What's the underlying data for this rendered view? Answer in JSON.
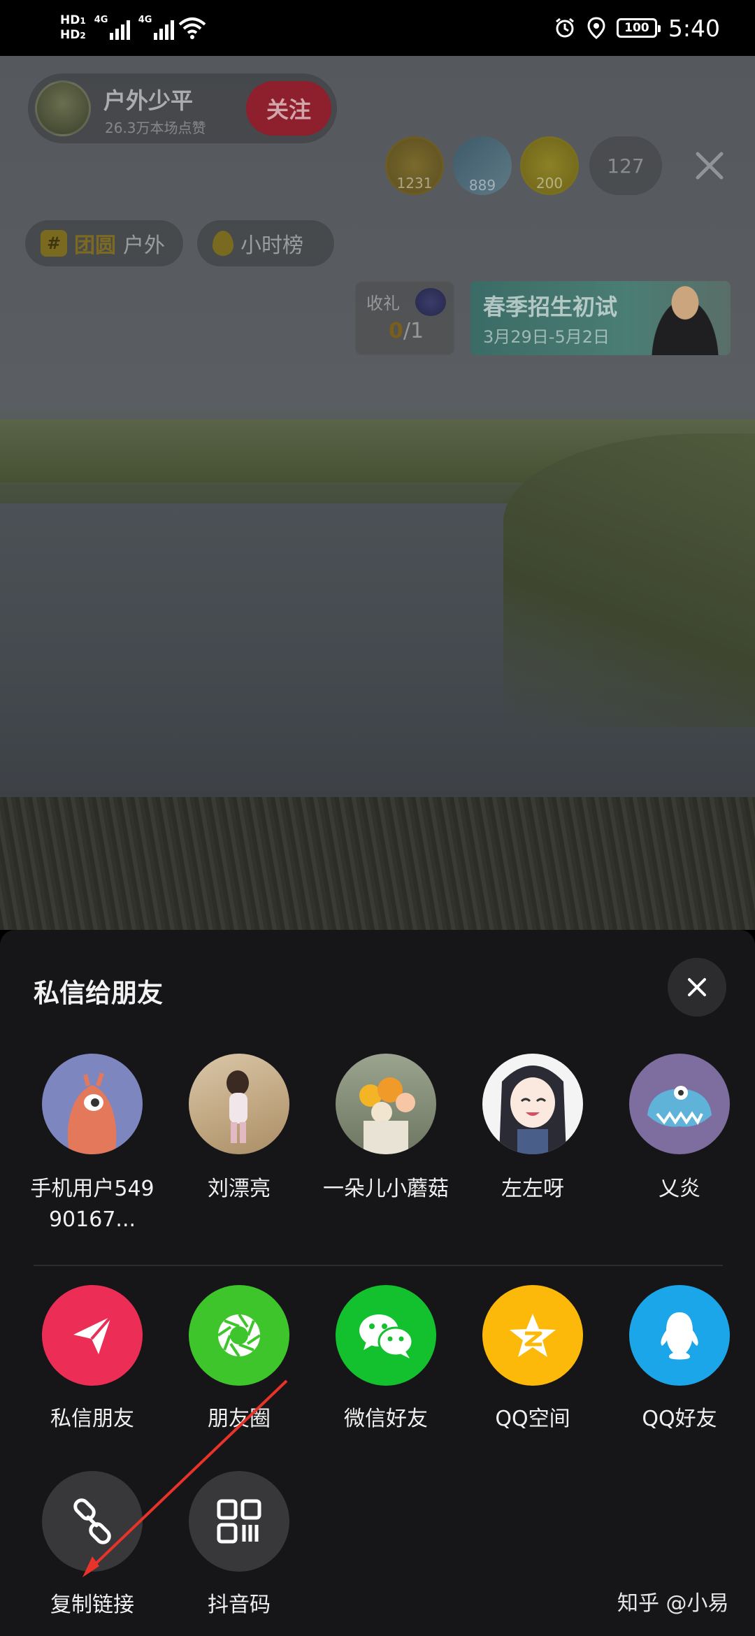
{
  "status_bar": {
    "hd1": "HD",
    "hd1_sub": "1",
    "hd2": "HD",
    "hd2_sub": "2",
    "net1": "4G",
    "net2": "4G",
    "battery": "100",
    "time": "5:40"
  },
  "live": {
    "host_name": "户外少平",
    "host_likes": "26.3万本场点赞",
    "follow_label": "关注",
    "viewers": [
      {
        "score": "1231"
      },
      {
        "score": "889"
      },
      {
        "score": "200"
      }
    ],
    "viewer_count": "127",
    "tags": [
      {
        "hot": "团圆",
        "label": "户外"
      },
      {
        "label": "小时榜"
      }
    ],
    "gift": {
      "label": "收礼",
      "current": "0",
      "total": "/1"
    },
    "banner": {
      "title": "春季招生初试",
      "dates": "3月29日-5月2日"
    }
  },
  "share_sheet": {
    "title": "私信给朋友",
    "friends": [
      {
        "name": "手机用户54990167..."
      },
      {
        "name": "刘漂亮"
      },
      {
        "name": "一朵儿小蘑菇"
      },
      {
        "name": "左左呀"
      },
      {
        "name": "乂炎"
      }
    ],
    "apps": [
      {
        "label": "私信朋友",
        "icon": "paper-plane-icon",
        "color": "#ec2e56"
      },
      {
        "label": "朋友圈",
        "icon": "moments-aperture-icon",
        "color": "#3ec52b"
      },
      {
        "label": "微信好友",
        "icon": "wechat-icon",
        "color": "#13c12e"
      },
      {
        "label": "QQ空间",
        "icon": "qzone-star-icon",
        "color": "#fdb909"
      },
      {
        "label": "QQ好友",
        "icon": "qq-penguin-icon",
        "color": "#1aa6e9"
      }
    ],
    "tools": [
      {
        "label": "复制链接",
        "icon": "link-icon",
        "color": "#38383a"
      },
      {
        "label": "抖音码",
        "icon": "qr-code-icon",
        "color": "#38383a"
      }
    ]
  },
  "watermark": "知乎 @小易",
  "colors": {
    "sheet_bg": "#161618",
    "annotation_arrow": "#e8322a"
  }
}
